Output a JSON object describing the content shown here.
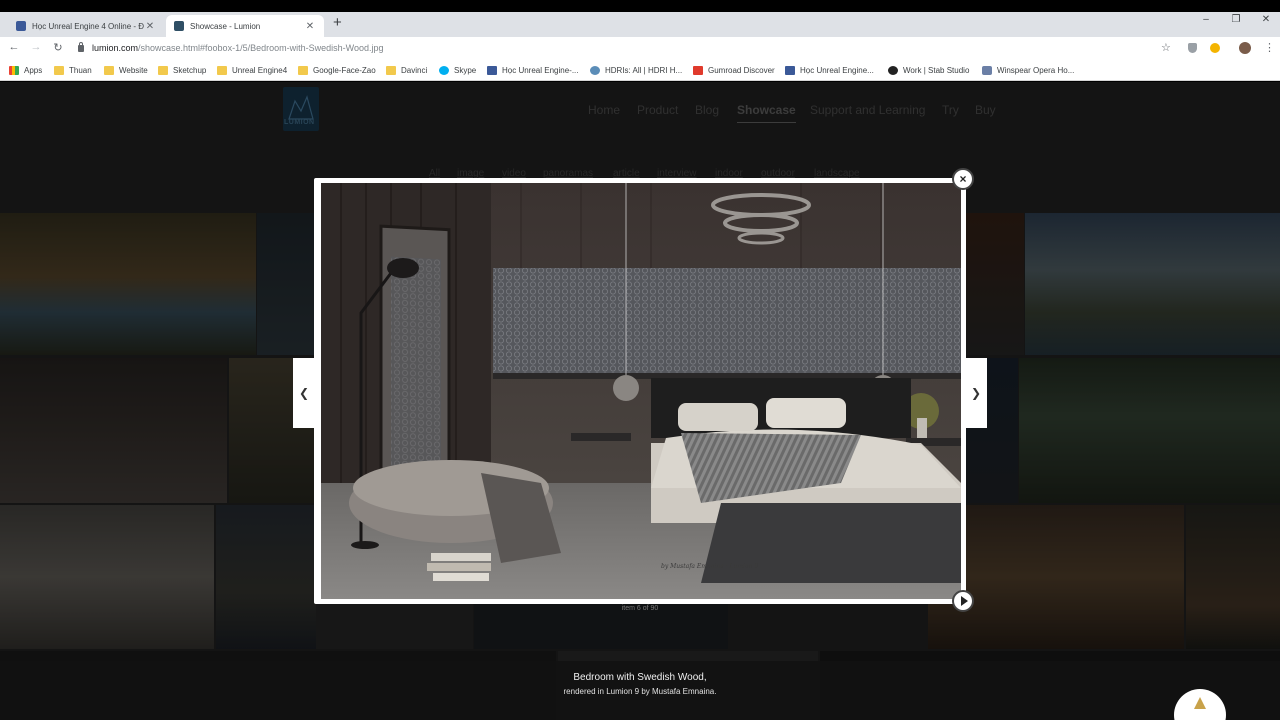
{
  "browser": {
    "tabs": [
      {
        "title": "Học Unreal Engine 4 Online - Đồ",
        "close": "✕",
        "active": false
      },
      {
        "title": "Showcase - Lumion",
        "close": "✕",
        "active": true
      }
    ],
    "new_tab": "+",
    "window_controls": {
      "minimize": "–",
      "maximize": "❐",
      "close": "✕"
    },
    "nav": {
      "back": "←",
      "forward": "→",
      "reload": "↻"
    },
    "url_host": "lumion.com",
    "url_path": "/showcase.html#foobox-1/5/Bedroom-with-Swedish-Wood.jpg",
    "omni_icons": {
      "star": "☆",
      "menu": "⋮"
    },
    "bookmarks": [
      {
        "label": "Apps",
        "icon": "apps"
      },
      {
        "label": "Thuan",
        "icon": "folder"
      },
      {
        "label": "Website",
        "icon": "folder"
      },
      {
        "label": "Sketchup",
        "icon": "folder"
      },
      {
        "label": "Unreal Engine4",
        "icon": "folder"
      },
      {
        "label": "Google-Face-Zao",
        "icon": "folder"
      },
      {
        "label": "Davinci",
        "icon": "folder"
      },
      {
        "label": "Skype",
        "icon": "skype"
      },
      {
        "label": "Học Unreal Engine-...",
        "icon": "facebook"
      },
      {
        "label": "HDRIs: All | HDRI H...",
        "icon": "hdri"
      },
      {
        "label": "Gumroad Discover",
        "icon": "gumroad"
      },
      {
        "label": "Học Unreal Engine...",
        "icon": "facebook"
      },
      {
        "label": "Work | Stab Studio",
        "icon": "stab"
      },
      {
        "label": "Winspear Opera Ho...",
        "icon": "opera"
      }
    ]
  },
  "site": {
    "logo_text": "LUMION",
    "nav": [
      "Home",
      "Product",
      "Blog",
      "Showcase",
      "Support and Learning",
      "Try",
      "Buy"
    ],
    "current_nav": "Showcase",
    "filters": [
      "All",
      "image",
      "video",
      "panoramas",
      "article",
      "interview",
      "indoor",
      "outdoor",
      "landscape"
    ]
  },
  "lightbox": {
    "close": "×",
    "prev": "❮",
    "next": "❯",
    "counter": "item 6 of 90",
    "image_signature": "by Mustafa Emnaina · Lumion 9",
    "caption_title": "Bedroom with Swedish Wood,",
    "caption_sub": "rendered in Lumion 9 by Mustafa Emnaina."
  },
  "colors": {
    "page_bg": "#262626",
    "modal_frame": "#ffffff",
    "lumion_blue": "#1b3c55"
  }
}
